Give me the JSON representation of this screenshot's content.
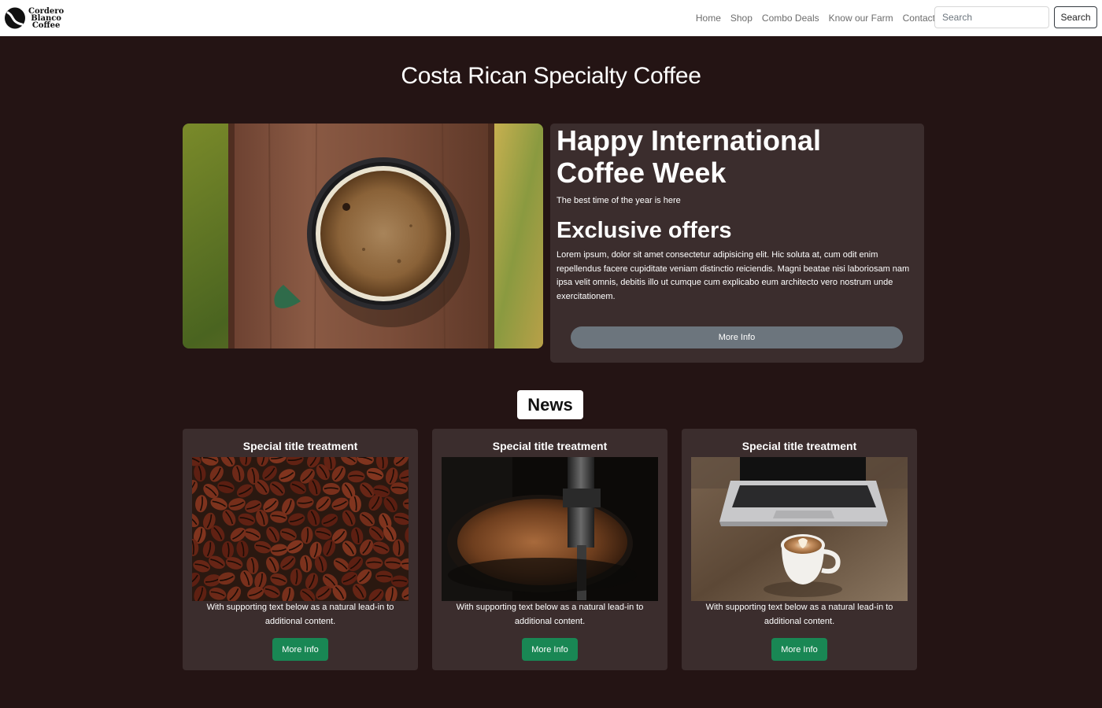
{
  "brand": {
    "name_lines": [
      "Cordero",
      "Blanco",
      "Coffee"
    ],
    "logo_icon": "coffee-bean-icon"
  },
  "nav": {
    "links": [
      "Home",
      "Shop",
      "Combo Deals",
      "Know our Farm",
      "Contact"
    ],
    "search_placeholder": "Search",
    "search_button": "Search"
  },
  "page_title": "Costa Rican Specialty Coffee",
  "hero": {
    "image_alt": "Top view of a cup of coffee on a wooden post",
    "heading": "Happy International Coffee Week",
    "subheading": "The best time of the year is here",
    "offer_heading": "Exclusive offers",
    "offer_text": "Lorem ipsum, dolor sit amet consectetur adipisicing elit. Hic soluta at, cum odit enim repellendus facere cupiditate veniam distinctio reiciendis. Magni beatae nisi laboriosam nam ipsa velit omnis, debitis illo ut cumque cum explicabo eum architecto vero nostrum unde exercitationem.",
    "button": "More Info"
  },
  "news": {
    "heading": "News",
    "cards": [
      {
        "title": "Special title treatment",
        "image": "coffee-beans-image",
        "text": "With supporting text below as a natural lead-in to additional content.",
        "button": "More Info"
      },
      {
        "title": "Special title treatment",
        "image": "coffee-roaster-image",
        "text": "With supporting text below as a natural lead-in to additional content.",
        "button": "More Info"
      },
      {
        "title": "Special title treatment",
        "image": "latte-laptop-image",
        "text": "With supporting text below as a natural lead-in to additional content.",
        "button": "More Info"
      }
    ]
  },
  "colors": {
    "page_background": "#241414",
    "card_background": "#3b2d2d",
    "primary_button": "#198754",
    "secondary_button": "#6c757d"
  }
}
